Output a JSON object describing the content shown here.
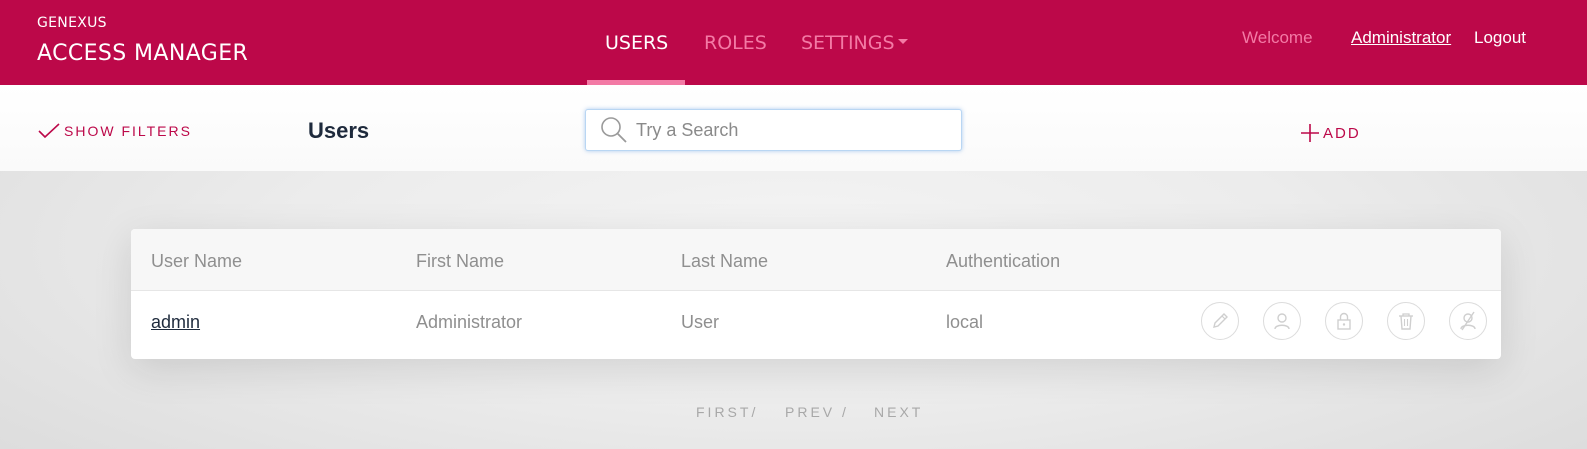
{
  "header": {
    "brand_small": "GENEXUS",
    "brand_big": "ACCESS MANAGER",
    "tabs": [
      {
        "label": "USERS"
      },
      {
        "label": "ROLES"
      },
      {
        "label": "SETTINGS"
      }
    ],
    "welcome": "Welcome",
    "user": "Administrator",
    "logout": "Logout"
  },
  "toolbar": {
    "show_filters": "SHOW FILTERS",
    "title": "Users",
    "search_placeholder": "Try a Search",
    "add": "ADD"
  },
  "table": {
    "columns": [
      "User Name",
      "First Name",
      "Last Name",
      "Authentication"
    ],
    "rows": [
      {
        "user_name": "admin",
        "first_name": "Administrator",
        "last_name": "User",
        "authentication": "local"
      }
    ],
    "row_actions": [
      "edit-icon",
      "user-roles-icon",
      "password-lock-icon",
      "delete-trash-icon",
      "disable-user-icon"
    ]
  },
  "pagination": {
    "first": "FIRST/",
    "prev": "PREV /",
    "next": "NEXT"
  },
  "colors": {
    "brand": "#bc0849",
    "brand_light": "#f37aa5",
    "title_text": "#1e2a3c",
    "muted_text": "#8f8f8f"
  }
}
